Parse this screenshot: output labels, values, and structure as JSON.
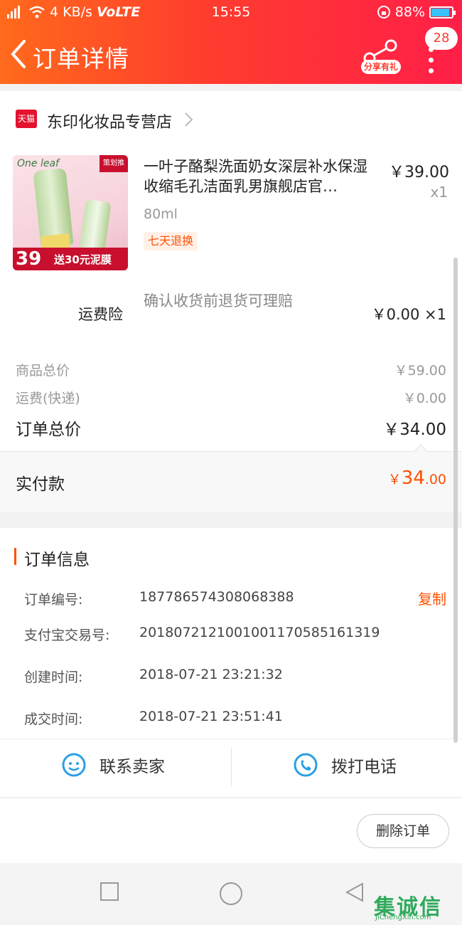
{
  "status_bar": {
    "network": "4G",
    "speed": "4 KB/s",
    "volte": "VoLTE",
    "time": "15:55",
    "battery": "88%",
    "battery_level": 0.88
  },
  "header": {
    "title": "订单详情",
    "share_label": "分享有礼",
    "message_count": "28"
  },
  "shop": {
    "platform_badge": "天猫",
    "name": "东印化妆品专营店"
  },
  "product": {
    "image": {
      "brand": "One leaf",
      "tag": "策划推",
      "price": "39",
      "promo": "送30元泥膜"
    },
    "title": "一叶子酪梨洗面奶女深层补水保湿收缩毛孔洁面乳男旗舰店官…",
    "price": "￥39.00",
    "quantity": "x1",
    "spec": "80ml",
    "service_tag": "七天退换"
  },
  "insurance": {
    "label": "运费险",
    "description": "确认收货前退货可理赔",
    "price": "￥0.00 ×1"
  },
  "summary": {
    "goods_label": "商品总价",
    "goods_value": "￥59.00",
    "shipping_label": "运费(快递)",
    "shipping_value": "￥0.00",
    "total_label": "订单总价",
    "total_value": "￥34.00",
    "paid_label": "实付款",
    "paid_currency": "￥",
    "paid_integer": "34",
    "paid_decimal": ".00"
  },
  "order_info": {
    "title": "订单信息",
    "order_no_label": "订单编号:",
    "order_no_value": "187786574308068388",
    "copy_label": "复制",
    "alipay_label": "支付宝交易号:",
    "alipay_value": "2018072121001001170585161319",
    "created_label": "创建时间:",
    "created_value": "2018-07-21 23:21:32",
    "deal_label": "成交时间:",
    "deal_value": "2018-07-21 23:51:41"
  },
  "contact": {
    "seller_label": "联系卖家",
    "call_label": "拨打电话"
  },
  "actions": {
    "delete_label": "删除订单"
  },
  "watermark": {
    "main": "集诚信",
    "sub": "JiChengXin.com"
  },
  "colors": {
    "accent": "#ff5000",
    "header_start": "#ff6a1c",
    "header_end": "#ff1f48",
    "tmall_red": "#e4112f"
  },
  "icons": [
    "back-arrow-icon",
    "share-icon",
    "more-dots-icon",
    "chevron-right-icon",
    "chat-face-icon",
    "phone-icon",
    "square-icon",
    "circle-icon",
    "triangle-back-icon"
  ]
}
